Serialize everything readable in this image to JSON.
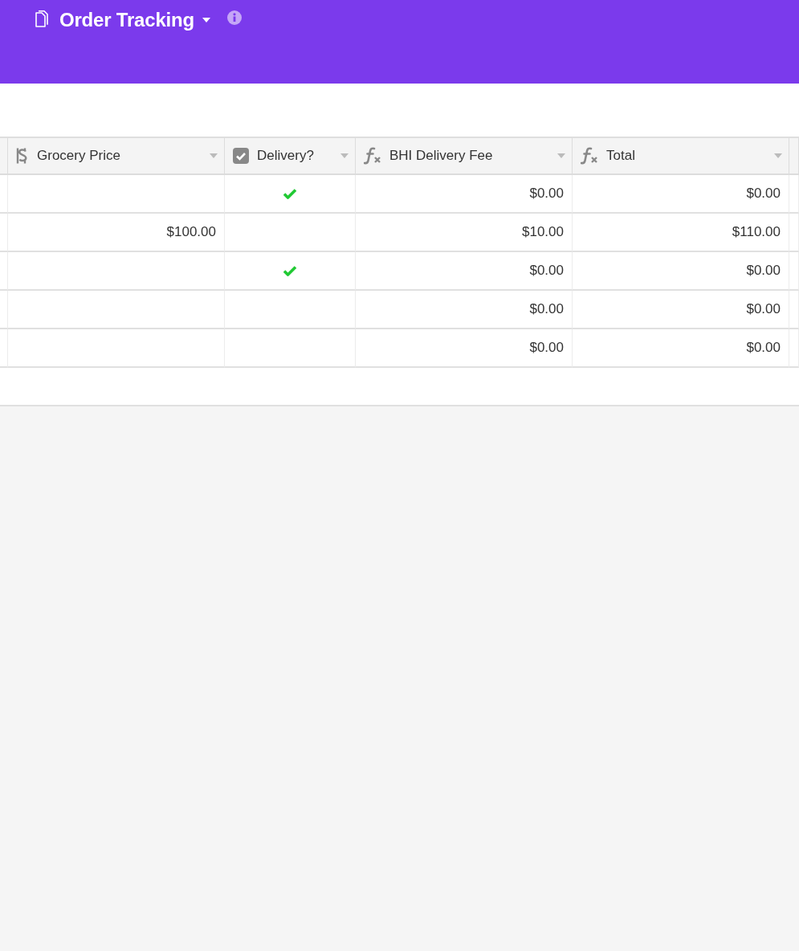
{
  "base": {
    "title": "Order Tracking"
  },
  "table": {
    "columns": [
      {
        "label": "Grocery Price",
        "kind": "currency"
      },
      {
        "label": "Delivery?",
        "kind": "checkbox"
      },
      {
        "label": "BHI Delivery Fee",
        "kind": "formula"
      },
      {
        "label": "Total",
        "kind": "formula"
      }
    ],
    "rows": [
      {
        "delivery": true,
        "bhi_delivery_fee": "$0.00",
        "total": "$0.00"
      },
      {
        "grocery_price": "$100.00",
        "delivery": false,
        "bhi_delivery_fee": "$10.00",
        "total": "$110.00"
      },
      {
        "delivery": true,
        "bhi_delivery_fee": "$0.00",
        "total": "$0.00"
      },
      {
        "delivery": false,
        "bhi_delivery_fee": "$0.00",
        "total": "$0.00"
      },
      {
        "delivery": false,
        "bhi_delivery_fee": "$0.00",
        "total": "$0.00"
      }
    ]
  }
}
